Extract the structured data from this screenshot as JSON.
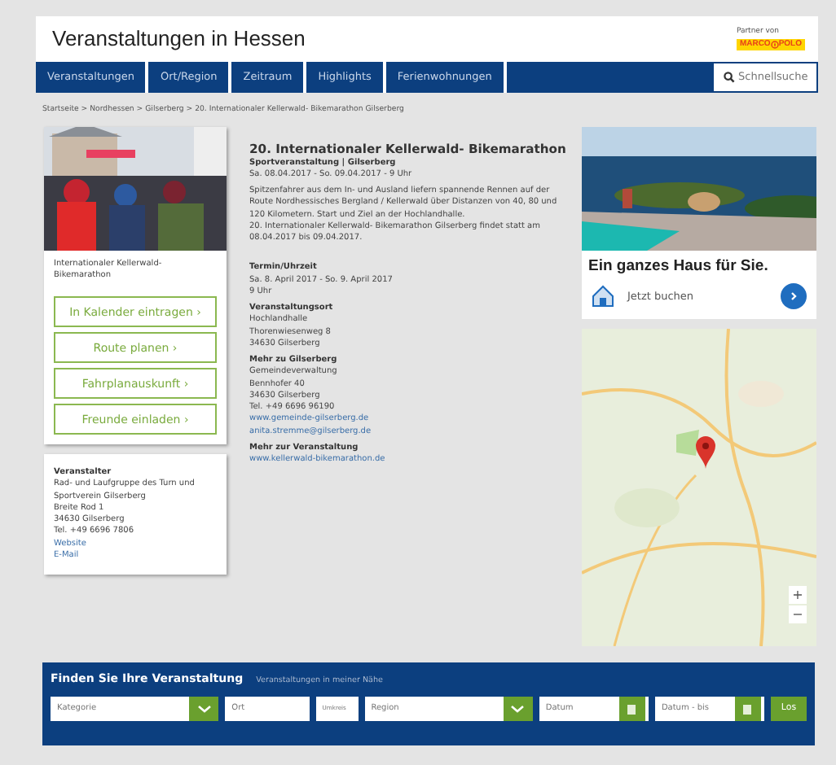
{
  "header": {
    "title": "Veranstaltungen in Hessen",
    "partner_label": "Partner von",
    "logo_left": "MARCO",
    "logo_right": "POLO"
  },
  "nav": {
    "items": [
      "Veranstaltungen",
      "Ort/Region",
      "Zeitraum",
      "Highlights",
      "Ferienwohnungen"
    ],
    "search_placeholder": "Schnellsuche"
  },
  "breadcrumb": {
    "separator": ">",
    "items": [
      "Startseite",
      "Nordhessen",
      "Gilserberg",
      "20. Internationaler Kellerwald- Bikemarathon Gilserberg"
    ]
  },
  "left": {
    "image": {
      "kind": "picture"
    },
    "caption": "Internationaler Kellerwald-Bikemarathon",
    "actions": [
      "In Kalender eintragen ›",
      "Route planen ›",
      "Fahrplanauskunft ›",
      "Freunde einladen ›"
    ],
    "organizer": {
      "heading": "Veranstalter",
      "lines": [
        "Rad- und Laufgruppe des Turn und Sportverein Gilserberg",
        "Breite Rod 1",
        "34630 Gilserberg",
        "Tel. +49 6696 7806"
      ],
      "links": [
        "Website",
        "E-Mail"
      ]
    }
  },
  "event": {
    "title": "20. Internationaler Kellerwald- Bikemarathon",
    "subtitle": "Sportveranstaltung | Gilserberg",
    "date": "Sa. 08.04.2017 - So. 09.04.2017 - 9 Uhr",
    "description": [
      "Spitzenfahrer aus dem In- und Ausland liefern spannende Rennen auf der Route Nordhessisches Bergland / Kellerwald über Distanzen von 40, 80 und 120 Kilometern. Start und Ziel an der Hochlandhalle.",
      "20. Internationaler Kellerwald- Bikemarathon Gilserberg findet statt am 08.04.2017 bis 09.04.2017."
    ],
    "sections": [
      {
        "heading": "Termin/Uhrzeit",
        "lines": [
          "Sa. 8. April 2017 - So. 9. April 2017",
          "9 Uhr"
        ]
      },
      {
        "heading": "Veranstaltungsort",
        "lines": [
          "Hochlandhalle",
          "Thorenwiesenweg 8",
          "34630 Gilserberg"
        ]
      },
      {
        "heading": "Mehr zu Gilserberg",
        "lines": [
          "Gemeindeverwaltung",
          "Bennhofer 40",
          "34630 Gilserberg",
          "Tel. +49 6696 96190"
        ],
        "links": [
          "www.gemeinde-gilserberg.de",
          "anita.stremme@gilserberg.de"
        ]
      },
      {
        "heading": "Mehr zur Veranstaltung",
        "links": [
          "www.kellerwald-bikemarathon.de"
        ]
      }
    ]
  },
  "ad": {
    "photo": {
      "kind": "picture"
    },
    "headline": "Ein ganzes Haus für Sie.",
    "cta": "Jetzt buchen"
  },
  "map": {
    "tile": {
      "kind": "picture"
    },
    "zoom_in": "+",
    "zoom_out": "−"
  },
  "finder": {
    "title": "Finden Sie Ihre Veranstaltung",
    "nearby": "Veranstaltungen in meiner Nähe",
    "fields": [
      {
        "kind": "select",
        "placeholder": "Kategorie"
      },
      {
        "kind": "input",
        "placeholder": "Ort"
      },
      {
        "kind": "small",
        "placeholder": "Umkreis"
      },
      {
        "kind": "select",
        "placeholder": "Region"
      },
      {
        "kind": "date",
        "placeholder": "Datum"
      },
      {
        "kind": "date",
        "placeholder": "Datum - bis"
      },
      {
        "kind": "button",
        "label": "Los"
      }
    ]
  }
}
